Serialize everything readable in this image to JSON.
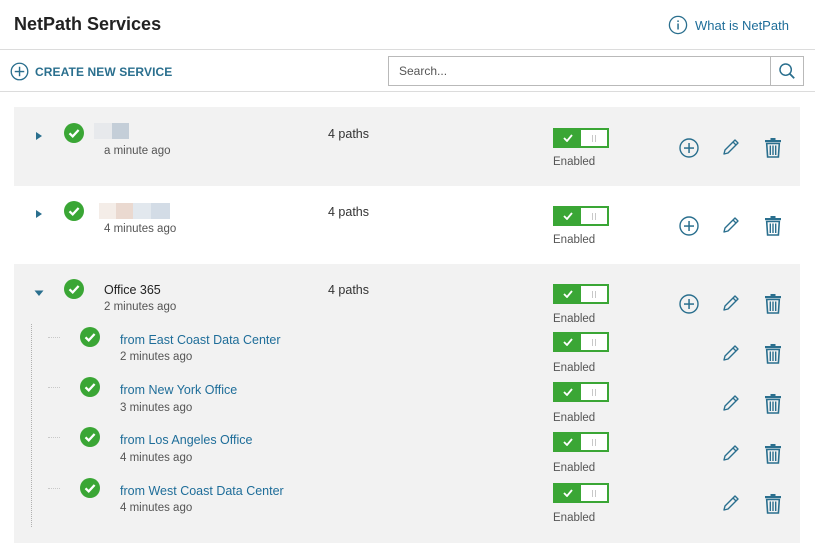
{
  "header": {
    "title": "NetPath Services",
    "help_label": "What is NetPath"
  },
  "toolbar": {
    "create_label": "CREATE NEW SERVICE",
    "search_placeholder": "Search..."
  },
  "colors": {
    "accent_link": "#1e6d99",
    "status_ok": "#3aa635",
    "row_highlight": "#f2f2f2",
    "icon": "#2a6f8e"
  },
  "services": [
    {
      "name": "",
      "name_redacted": true,
      "time": "a minute ago",
      "paths": "4 paths",
      "toggle": "Enabled",
      "expanded": false,
      "status": "ok"
    },
    {
      "name": "",
      "name_redacted": true,
      "time": "4 minutes ago",
      "paths": "4 paths",
      "toggle": "Enabled",
      "expanded": false,
      "status": "ok"
    },
    {
      "name": "Office 365",
      "name_redacted": false,
      "time": "2 minutes ago",
      "paths": "4 paths",
      "toggle": "Enabled",
      "expanded": true,
      "status": "ok",
      "children": [
        {
          "name": "from East Coast Data Center",
          "time": "2 minutes ago",
          "toggle": "Enabled",
          "status": "ok"
        },
        {
          "name": "from New York Office",
          "time": "3 minutes ago",
          "toggle": "Enabled",
          "status": "ok"
        },
        {
          "name": "from Los Angeles Office",
          "time": "4 minutes ago",
          "toggle": "Enabled",
          "status": "ok"
        },
        {
          "name": "from West Coast Data Center",
          "time": "4 minutes ago",
          "toggle": "Enabled",
          "status": "ok"
        }
      ]
    }
  ]
}
